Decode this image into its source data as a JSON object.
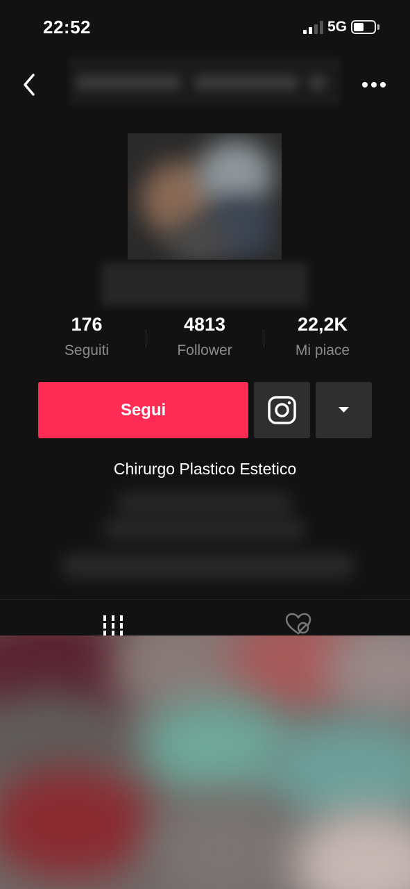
{
  "status_bar": {
    "time": "22:52",
    "network": "5G"
  },
  "nav": {
    "back_icon": "chevron-left-icon",
    "more_icon": "more-horizontal-icon"
  },
  "stats": [
    {
      "value": "176",
      "label": "Seguiti"
    },
    {
      "value": "4813",
      "label": "Follower"
    },
    {
      "value": "22,2K",
      "label": "Mi piace"
    }
  ],
  "actions": {
    "follow_label": "Segui",
    "instagram_icon": "instagram-icon",
    "dropdown_icon": "caret-down-icon"
  },
  "bio": {
    "text": "Chirurgo Plastico Estetico"
  },
  "tabs": [
    {
      "icon": "grid-icon",
      "selected": true
    },
    {
      "icon": "liked-hidden-icon",
      "selected": false
    }
  ],
  "colors": {
    "background": "#121212",
    "accent": "#fe2c55",
    "secondary_button": "#2f2f2f",
    "muted_text": "#8a8a8a"
  }
}
